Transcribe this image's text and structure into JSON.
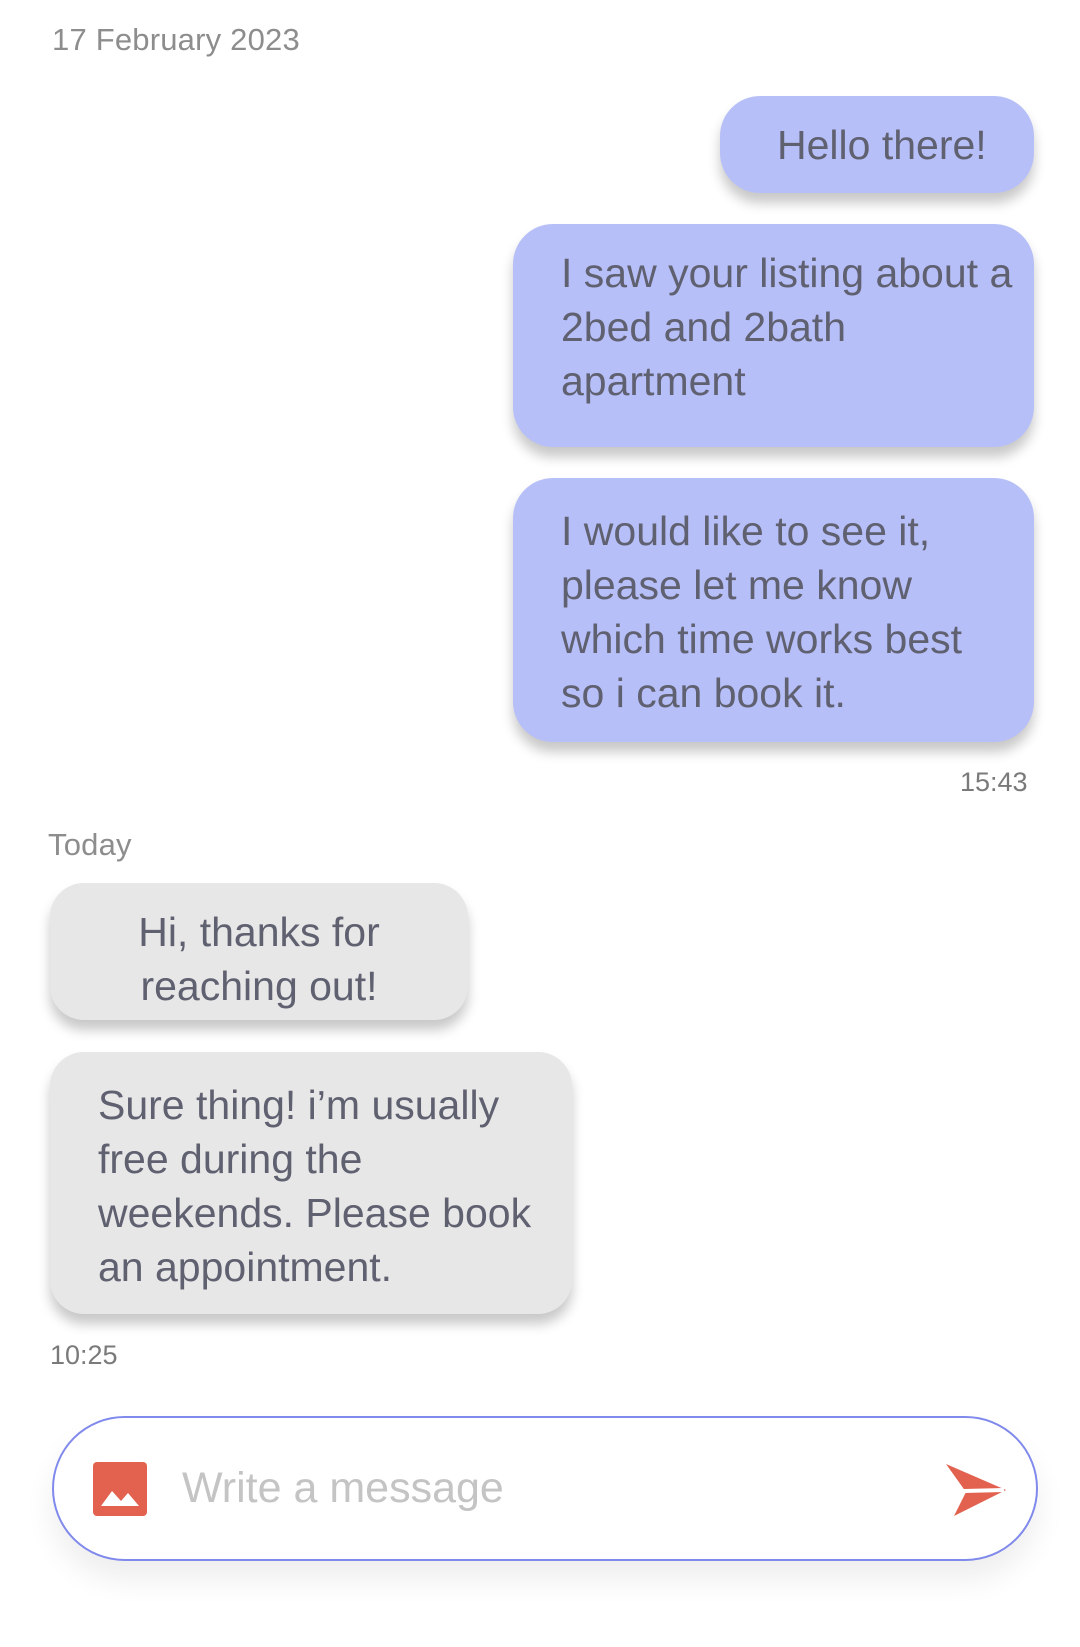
{
  "conversation": {
    "earlier_date": "17 February 2023",
    "sent_messages": [
      {
        "text": "Hello there!"
      },
      {
        "text": "I saw your listing about a 2bed and 2bath apartment"
      },
      {
        "text": "I would like to see it, please let me know which time works best so i can book it."
      }
    ],
    "sent_time": "15:43",
    "today_label": "Today",
    "received_messages": [
      {
        "text": "Hi, thanks for reaching out!"
      },
      {
        "text": "Sure thing! i’m usually free during the weekends. Please book an appointment."
      }
    ],
    "received_time": "10:25"
  },
  "composer": {
    "placeholder": "Write a message",
    "value": "",
    "attach_icon": "image-icon",
    "send_icon": "send-icon"
  },
  "colors": {
    "sent_bubble": "#b7bff8",
    "received_bubble": "#e7e7e7",
    "composer_border": "#8089ec",
    "icon_accent": "#e2624f"
  }
}
